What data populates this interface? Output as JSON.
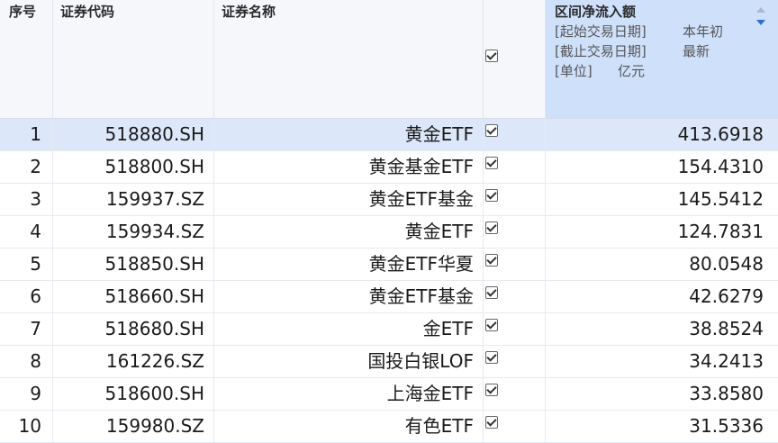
{
  "header": {
    "seq": "序号",
    "code": "证券代码",
    "name": "证券名称",
    "flow": {
      "title": "区间净流入额",
      "params": [
        {
          "label": "[起始交易日期]",
          "value": "本年初"
        },
        {
          "label": "[截止交易日期]",
          "value": "最新"
        },
        {
          "label": "[单位]",
          "value": "亿元"
        }
      ],
      "sort": "descending"
    }
  },
  "rows": [
    {
      "seq": "1",
      "code": "518880.SH",
      "name": "黄金ETF",
      "checked": true,
      "flow": "413.6918"
    },
    {
      "seq": "2",
      "code": "518800.SH",
      "name": "黄金基金ETF",
      "checked": true,
      "flow": "154.4310"
    },
    {
      "seq": "3",
      "code": "159937.SZ",
      "name": "黄金ETF基金",
      "checked": true,
      "flow": "145.5412"
    },
    {
      "seq": "4",
      "code": "159934.SZ",
      "name": "黄金ETF",
      "checked": true,
      "flow": "124.7831"
    },
    {
      "seq": "5",
      "code": "518850.SH",
      "name": "黄金ETF华夏",
      "checked": true,
      "flow": "80.0548"
    },
    {
      "seq": "6",
      "code": "518660.SH",
      "name": "黄金ETF基金",
      "checked": true,
      "flow": "42.6279"
    },
    {
      "seq": "7",
      "code": "518680.SH",
      "name": "金ETF",
      "checked": true,
      "flow": "38.8524"
    },
    {
      "seq": "8",
      "code": "161226.SZ",
      "name": "国投白银LOF",
      "checked": true,
      "flow": "34.2413"
    },
    {
      "seq": "9",
      "code": "518600.SH",
      "name": "上海金ETF",
      "checked": true,
      "flow": "33.8580"
    },
    {
      "seq": "10",
      "code": "159980.SZ",
      "name": "有色ETF",
      "checked": true,
      "flow": "31.5336"
    }
  ],
  "selected_row": 1,
  "colors": {
    "header_bg": "#f5f7fb",
    "flow_header_bg": "#cfe0fb",
    "selected_row_bg": "#dce8fa",
    "sort_accent": "#2f6fd6"
  }
}
